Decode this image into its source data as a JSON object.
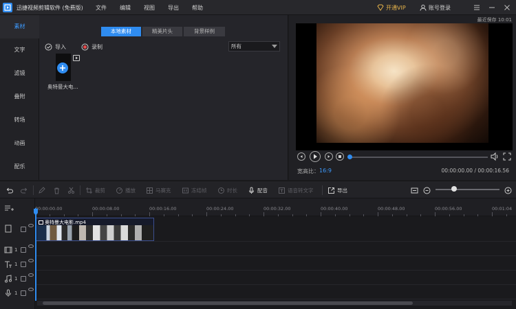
{
  "app": {
    "title": "迅捷视频剪辑软件 (免费版)",
    "menu": [
      "文件",
      "编辑",
      "视图",
      "导出",
      "帮助"
    ],
    "vip_label": "开通VIP",
    "login_label": "账号登录",
    "autosave": "最近保存 10:01"
  },
  "colors": {
    "accent": "#2f8cf0",
    "vip": "#e6b34a",
    "background": "#1c1c1f"
  },
  "sidebar": {
    "items": [
      {
        "label": "素材",
        "active": true
      },
      {
        "label": "文字",
        "active": false
      },
      {
        "label": "滤镜",
        "active": false
      },
      {
        "label": "叠附",
        "active": false
      },
      {
        "label": "转场",
        "active": false
      },
      {
        "label": "动画",
        "active": false
      },
      {
        "label": "配乐",
        "active": false
      }
    ]
  },
  "media": {
    "tabs": [
      {
        "label": "本地素材",
        "active": true
      },
      {
        "label": "精美片头",
        "active": false
      },
      {
        "label": "背景样例",
        "active": false
      }
    ],
    "import_label": "导入",
    "record_label": "录制",
    "filter_value": "所有",
    "items": [
      {
        "name": "奥特曼大电..."
      }
    ]
  },
  "preview": {
    "aspect_label": "宽高比：",
    "aspect_value": "16:9",
    "timecode": "00:00:00.00 / 00:00:16.56",
    "progress": 0
  },
  "toolbar": {
    "undo_icon": "undo-icon",
    "redo_icon": "redo-icon",
    "crop_label": "裁剪",
    "speed_label": "播放",
    "mosaic_label": "马赛克",
    "freeze_label": "冻结帧",
    "duration_label": "时长",
    "dub_label": "配音",
    "speech_label": "语音转文字",
    "export_label": "导出"
  },
  "timeline": {
    "ticks": [
      "00:00:00.00",
      "00:00:08.00",
      "00:00:16.00",
      "00:00:24.00",
      "00:00:32.00",
      "00:00:40.00",
      "00:00:48.00",
      "00:00:56.00",
      "00:01:04"
    ],
    "clip_name": "奥特曼大电影.mp4",
    "track_numbers": [
      "1",
      "1",
      "1",
      "1"
    ],
    "zoom_level": 0.25
  }
}
